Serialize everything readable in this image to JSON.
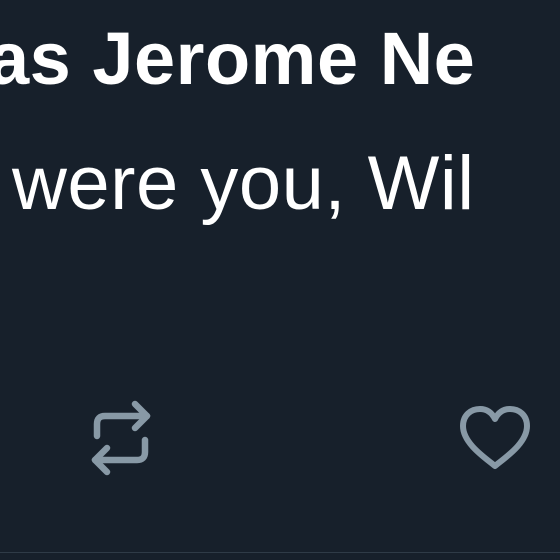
{
  "tweet": {
    "author_fragment": "as Jerome Ne",
    "text_fragment": "were you, Wil"
  },
  "actions": {
    "retweet_icon": "retweet-icon",
    "like_icon": "heart-icon",
    "icon_color": "#8899a6"
  },
  "colors": {
    "background": "#17202b",
    "text": "#ffffff",
    "divider": "#2f3b47"
  }
}
